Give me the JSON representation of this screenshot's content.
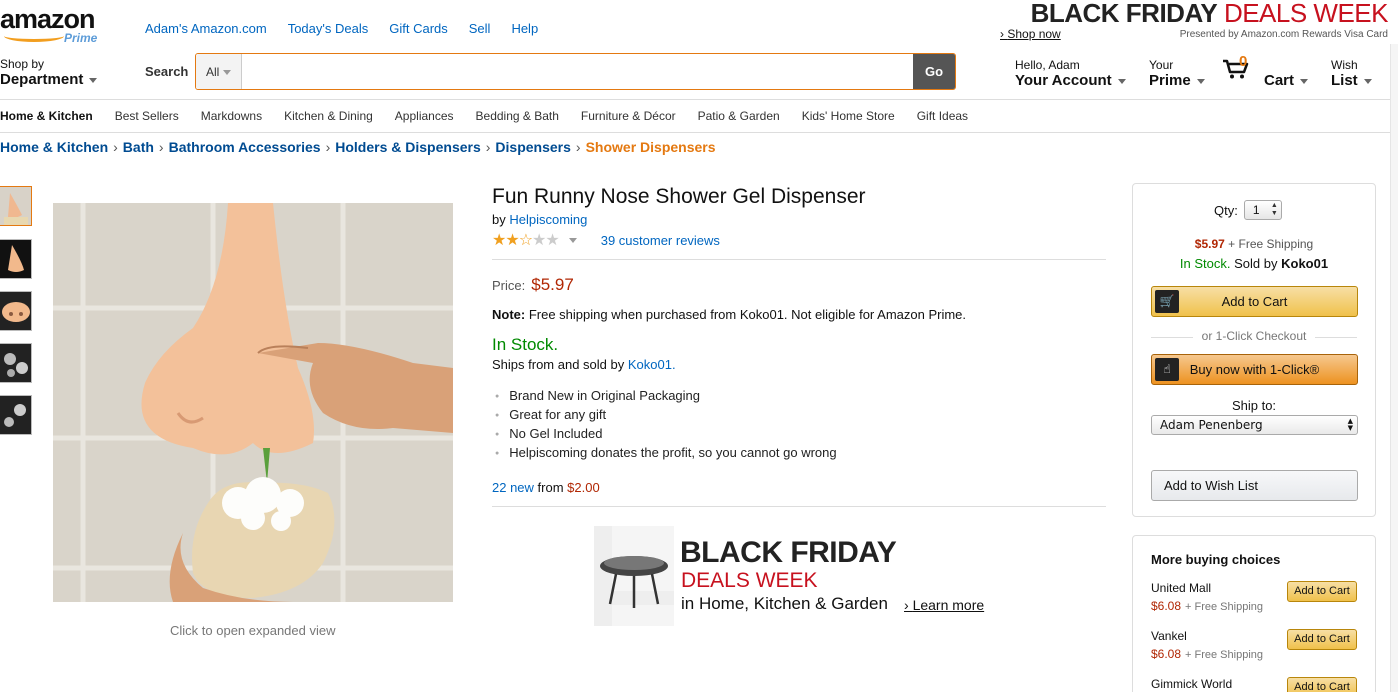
{
  "header": {
    "logo_text": "amazon",
    "logo_sub": "Prime",
    "top_links": [
      "Adam's Amazon.com",
      "Today's Deals",
      "Gift Cards",
      "Sell",
      "Help"
    ],
    "promo": {
      "black": "BLACK FRIDAY",
      "deals": "DEALS WEEK",
      "shop_now": "Shop now",
      "presented": "Presented by Amazon.com Rewards Visa Card"
    },
    "shop_by_line1": "Shop by",
    "shop_by_line2": "Department",
    "search_label": "Search",
    "search_category": "All",
    "search_value": "",
    "go_label": "Go",
    "account_line1": "Hello, Adam",
    "account_line2": "Your Account",
    "prime_line1": "Your",
    "prime_line2": "Prime",
    "cart_count": "0",
    "cart_label": "Cart",
    "wish_line1": "Wish",
    "wish_line2": "List"
  },
  "nav": [
    "Home & Kitchen",
    "Best Sellers",
    "Markdowns",
    "Kitchen & Dining",
    "Appliances",
    "Bedding & Bath",
    "Furniture & Décor",
    "Patio & Garden",
    "Kids' Home Store",
    "Gift Ideas"
  ],
  "breadcrumb": {
    "items": [
      "Home & Kitchen",
      "Bath",
      "Bathroom Accessories",
      "Holders & Dispensers",
      "Dispensers"
    ],
    "separator": "›",
    "current": "Shower Dispensers"
  },
  "image": {
    "caption": "Click to open expanded view"
  },
  "product": {
    "title": "Fun Runny Nose Shower Gel Dispenser",
    "by_label": "by",
    "brand": "Helpiscoming",
    "rating": 2.5,
    "reviews": "39 customer reviews",
    "price_label": "Price:",
    "price": "$5.97",
    "note_label": "Note:",
    "note_text": "Free shipping when purchased from Koko01. Not eligible for Amazon Prime.",
    "stock": "In Stock.",
    "ships_prefix": "Ships from and sold by",
    "ships_seller": "Koko01.",
    "bullets": [
      "Brand New in Original Packaging",
      "Great for any gift",
      "No Gel Included",
      "Helpiscoming donates the profit, so you cannot go wrong"
    ],
    "new_count": "22 new",
    "new_from": "from",
    "new_price": "$2.00"
  },
  "ad": {
    "line1": "BLACK FRIDAY",
    "line2": "DEALS WEEK",
    "line3": "in Home, Kitchen & Garden",
    "learn_more": "Learn more"
  },
  "buybox": {
    "qty_label": "Qty:",
    "qty_value": "1",
    "price": "$5.97",
    "shipping": "+ Free Shipping",
    "stock": "In Stock.",
    "sold_by": "Sold by",
    "seller": "Koko01",
    "add_to_cart": "Add to Cart",
    "oneclick_label": "or 1-Click Checkout",
    "buy_now": "Buy now with 1-Click®",
    "ship_to_label": "Ship to:",
    "ship_to_value": "Adam Penenberg",
    "wishlist": "Add to Wish List"
  },
  "more_buying": {
    "title": "More buying choices",
    "offers": [
      {
        "seller": "United Mall",
        "price": "$6.08",
        "shipping": "+ Free Shipping",
        "button": "Add to Cart"
      },
      {
        "seller": "Vankel",
        "price": "$6.08",
        "shipping": "+ Free Shipping",
        "button": "Add to Cart"
      },
      {
        "seller": "Gimmick World",
        "price": "",
        "shipping": "",
        "button": "Add to Cart"
      }
    ]
  },
  "colors": {
    "accent_orange": "#e47911",
    "price_red": "#b12704",
    "stock_green": "#008a00",
    "link_blue": "#0066c0",
    "promo_red": "#c7111e"
  }
}
